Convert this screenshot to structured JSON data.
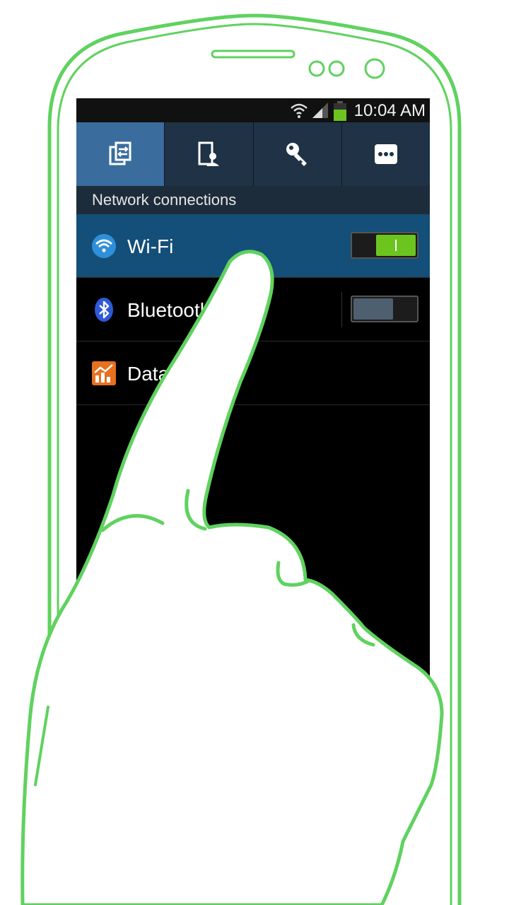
{
  "status_bar": {
    "time": "10:04 AM",
    "icons": [
      "wifi-icon",
      "signal-icon",
      "battery-icon"
    ]
  },
  "tabs": [
    {
      "name": "connections-tab",
      "icon": "connections-icon",
      "active": true
    },
    {
      "name": "device-tab",
      "icon": "device-icon",
      "active": false
    },
    {
      "name": "accounts-tab",
      "icon": "key-icon",
      "active": false
    },
    {
      "name": "more-tab",
      "icon": "more-icon",
      "active": false
    }
  ],
  "section": {
    "title": "Network connections"
  },
  "settings": [
    {
      "label": "Wi-Fi",
      "icon": "wifi-icon",
      "toggle": true,
      "enabled": true
    },
    {
      "label": "Bluetooth",
      "icon": "bluetooth-icon",
      "toggle": true,
      "enabled": false
    },
    {
      "label": "Data usage",
      "icon": "data-usage-icon",
      "toggle": false
    }
  ],
  "colors": {
    "outline_green": "#5fd25f",
    "active_row": "#134f78",
    "toggle_on": "#6cc51f",
    "toggle_off_knob": "#4e5f70"
  }
}
